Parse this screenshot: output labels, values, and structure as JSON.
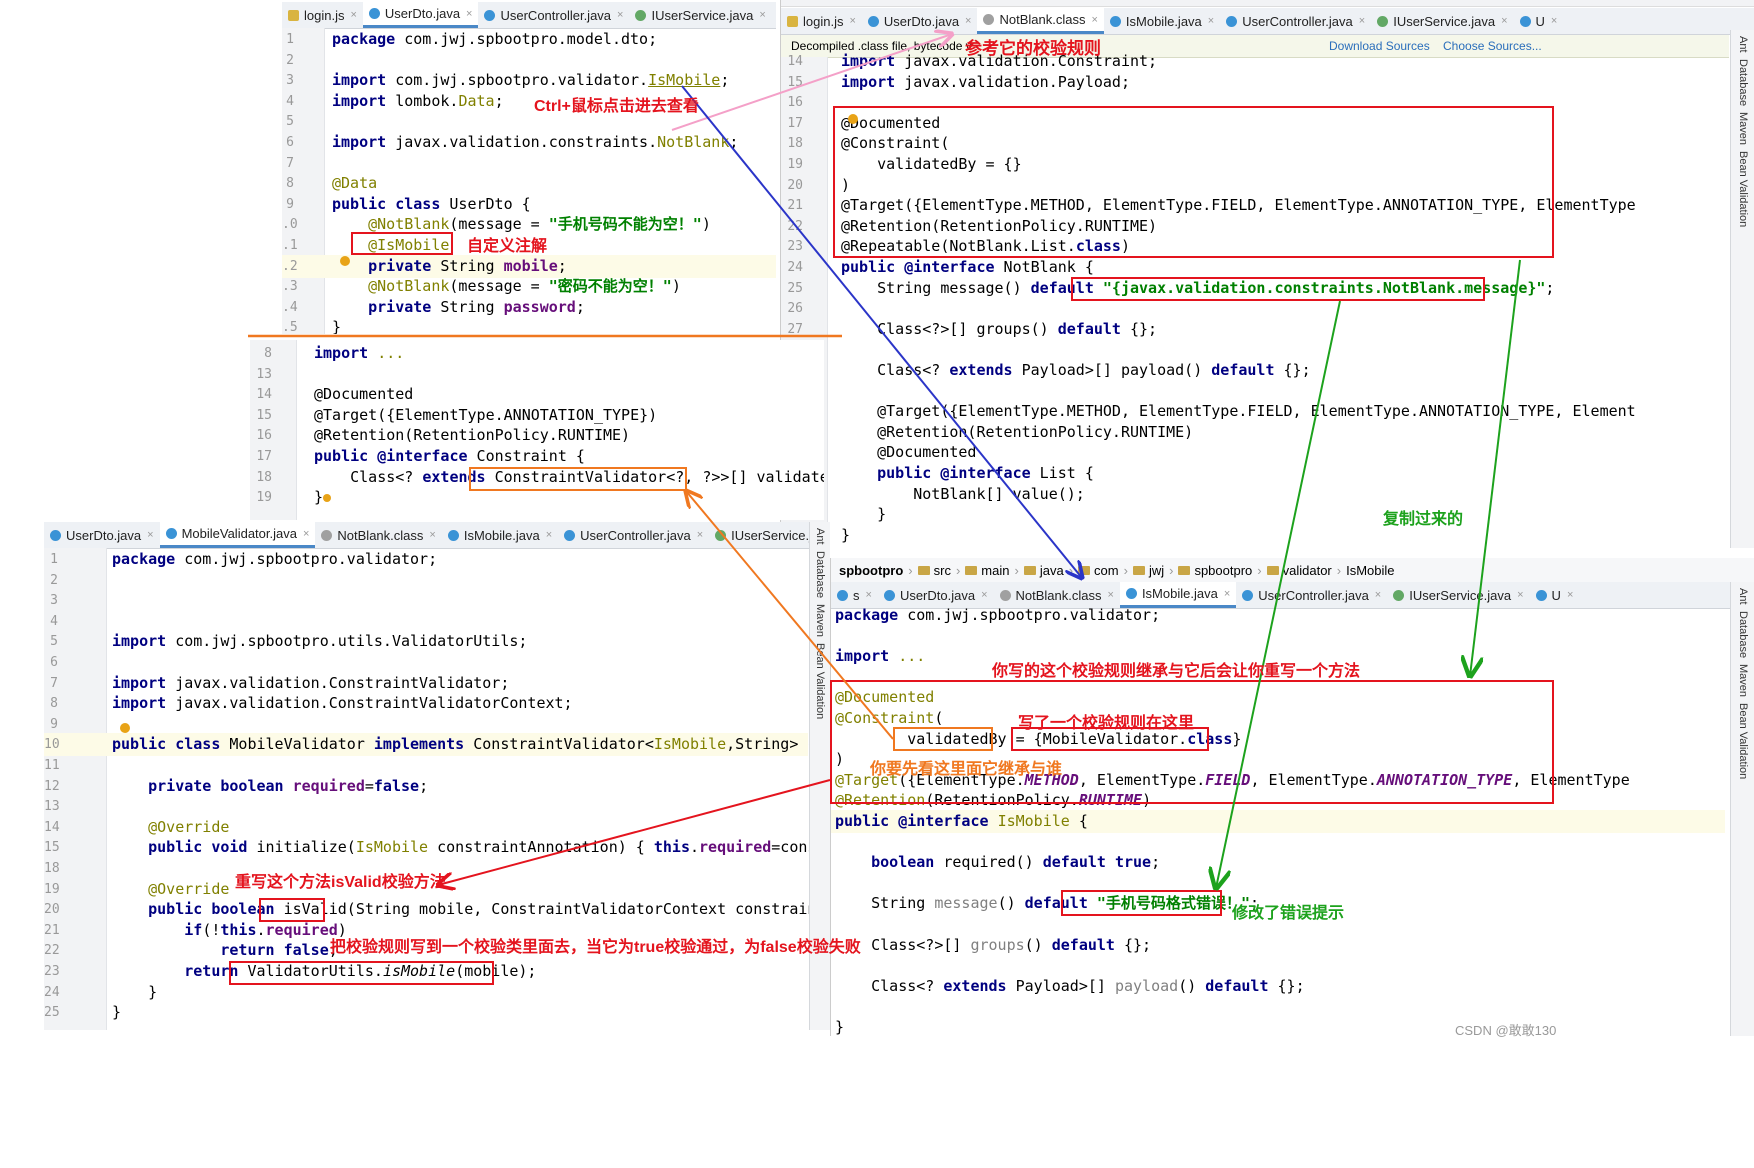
{
  "p1": {
    "tabs": [
      "login.js",
      "UserDto.java",
      "UserController.java",
      "IUserService.java",
      "Use"
    ],
    "lines": [
      {
        "n": "1",
        "html": "<span class='kw'>package</span> com.jwj.spbootpro.model.dto;"
      },
      {
        "n": "2",
        "html": ""
      },
      {
        "n": "3",
        "html": "<span class='kw'>import</span> com.jwj.spbootpro.validator.<span class='an' style='text-decoration:underline'>IsMobile</span>;"
      },
      {
        "n": "4",
        "html": "<span class='kw'>import</span> lombok.<span class='an'>Data</span>;"
      },
      {
        "n": "5",
        "html": ""
      },
      {
        "n": "6",
        "html": "<span class='kw'>import</span> javax.validation.constraints.<span class='an'>NotBlank</span>;"
      },
      {
        "n": "7",
        "html": ""
      },
      {
        "n": "8",
        "html": "<span class='an'>@Data</span>"
      },
      {
        "n": "9",
        "html": "<span class='kw'>public class</span> UserDto {"
      },
      {
        "n": ".0",
        "html": "    <span class='an'>@NotBlank</span>(message = <span class='str'>\"手机号码不能为空！\"</span>)"
      },
      {
        "n": ".1",
        "html": "    <span class='an'>@IsMobile</span>"
      },
      {
        "n": ".2",
        "html": "    <span class='kw'>private</span> String <span class='fld'>mobile</span>;"
      },
      {
        "n": ".3",
        "html": "    <span class='an'>@NotBlank</span>(message = <span class='str'>\"密码不能为空！\"</span>)"
      },
      {
        "n": ".4",
        "html": "    <span class='kw'>private</span> String <span class='fld'>password</span>;"
      },
      {
        "n": ".5",
        "html": "}"
      }
    ]
  },
  "p2": {
    "tabs": [
      "login.js",
      "UserDto.java",
      "NotBlank.class",
      "IsMobile.java",
      "UserController.java",
      "IUserService.java",
      "U"
    ],
    "decompiled_notice": "Decompiled .class file, bytecode v",
    "download_sources": "Download Sources",
    "choose_sources": "Choose Sources...",
    "sidebar_labels": [
      "Ant",
      "Database",
      "Maven",
      "Bean Validation"
    ],
    "lines": [
      {
        "n": "14",
        "html": "<span class='kw'>import</span> javax.validation.Constraint;"
      },
      {
        "n": "15",
        "html": "<span class='kw'>import</span> javax.validation.Payload;"
      },
      {
        "n": "16",
        "html": ""
      },
      {
        "n": "17",
        "html": "@Documented"
      },
      {
        "n": "18",
        "html": "@Constraint("
      },
      {
        "n": "19",
        "html": "    validatedBy = {}"
      },
      {
        "n": "20",
        "html": ")"
      },
      {
        "n": "21",
        "html": "@Target({ElementType.METHOD, ElementType.FIELD, ElementType.ANNOTATION_TYPE, ElementType"
      },
      {
        "n": "22",
        "html": "@Retention(RetentionPolicy.RUNTIME)"
      },
      {
        "n": "23",
        "html": "@Repeatable(NotBlank.List.<span class='kw'>class</span>)"
      },
      {
        "n": "24",
        "html": "<span class='kw'>public @interface</span> NotBlank {"
      },
      {
        "n": "25",
        "html": "    String message() <span class='kw'>default</span> <span class='str'>\"{javax.validation.constraints.NotBlank.message}\"</span>;"
      },
      {
        "n": "26",
        "html": ""
      },
      {
        "n": "27",
        "html": "    Class&lt;?&gt;[] groups() <span class='kw'>default</span> {};"
      },
      {
        "n": "",
        "html": ""
      },
      {
        "n": "",
        "html": "    Class&lt;? <span class='kw'>extends</span> Payload&gt;[] payload() <span class='kw'>default</span> {};"
      },
      {
        "n": "",
        "html": ""
      },
      {
        "n": "",
        "html": "    @Target({ElementType.METHOD, ElementType.FIELD, ElementType.ANNOTATION_TYPE, Element"
      },
      {
        "n": "",
        "html": "    @Retention(RetentionPolicy.RUNTIME)"
      },
      {
        "n": "",
        "html": "    @Documented"
      },
      {
        "n": "",
        "html": "    <span class='kw'>public @interface</span> List {"
      },
      {
        "n": "",
        "html": "        NotBlank[] value();"
      },
      {
        "n": "",
        "html": "    }"
      },
      {
        "n": "",
        "html": "}"
      }
    ]
  },
  "p3": {
    "lines": [
      {
        "n": "8",
        "html": "<span class='kw'>import</span> <span class='an'>...</span>"
      },
      {
        "n": "13",
        "html": ""
      },
      {
        "n": "14",
        "html": "@Documented"
      },
      {
        "n": "15",
        "html": "@Target({ElementType.ANNOTATION_TYPE})"
      },
      {
        "n": "16",
        "html": "@Retention(RetentionPolicy.RUNTIME)"
      },
      {
        "n": "17",
        "html": "<span class='kw'>public @interface</span> Constraint {"
      },
      {
        "n": "18",
        "html": "    Class&lt;? <span class='kw'>extends</span> ConstraintValidator&lt;?, ?&gt;&gt;[] validatedBy();"
      },
      {
        "n": "19",
        "html": "}"
      }
    ]
  },
  "p4": {
    "tabs": [
      "UserDto.java",
      "MobileValidator.java",
      "NotBlank.class",
      "IsMobile.java",
      "UserController.java",
      "IUserService.java"
    ],
    "sidebar_labels": [
      "Ant",
      "Database",
      "Maven",
      "Bean Validation"
    ],
    "lines": [
      {
        "n": "1",
        "html": "<span class='kw'>package</span> com.jwj.spbootpro.validator;"
      },
      {
        "n": "2",
        "html": ""
      },
      {
        "n": "3",
        "html": ""
      },
      {
        "n": "4",
        "html": ""
      },
      {
        "n": "5",
        "html": "<span class='kw'>import</span> com.jwj.spbootpro.utils.ValidatorUtils;"
      },
      {
        "n": "6",
        "html": ""
      },
      {
        "n": "7",
        "html": "<span class='kw'>import</span> javax.validation.ConstraintValidator;"
      },
      {
        "n": "8",
        "html": "<span class='kw'>import</span> javax.validation.ConstraintValidatorContext;"
      },
      {
        "n": "9",
        "html": ""
      },
      {
        "n": "10",
        "html": "<span class='kw'>public class</span> MobileValidator <span class='kw'>implements</span> ConstraintValidator&lt;<span class='an'>IsMobile</span>,String&gt; {"
      },
      {
        "n": "11",
        "html": ""
      },
      {
        "n": "12",
        "html": "    <span class='kw'>private boolean</span> <span class='fld'>required</span>=<span class='kw'>false</span>;"
      },
      {
        "n": "13",
        "html": ""
      },
      {
        "n": "14",
        "html": "    <span class='an'>@Override</span>"
      },
      {
        "n": "15",
        "html": "    <span class='kw'>public void</span> initialize(<span class='an'>IsMobile</span> constraintAnnotation) { <span class='kw'>this</span>.<span class='fld'>required</span>=constraintAnn"
      },
      {
        "n": "18",
        "html": ""
      },
      {
        "n": "19",
        "html": "    <span class='an'>@Override</span>"
      },
      {
        "n": "20",
        "html": "    <span class='kw'>public boolean</span> isValid(String mobile, ConstraintValidatorContext constraintValidatc"
      },
      {
        "n": "21",
        "html": "        <span class='kw'>if</span>(!<span class='kw'>this</span>.<span class='fld'>required</span>)"
      },
      {
        "n": "22",
        "html": "            <span class='kw'>return false</span>;"
      },
      {
        "n": "23",
        "html": "        <span class='kw'>return</span> ValidatorUtils.<span class='ital'>isMobile</span>(mobile);"
      },
      {
        "n": "24",
        "html": "    }"
      },
      {
        "n": "25",
        "html": "}"
      }
    ]
  },
  "p5": {
    "breadcrumb": [
      "spbootpro",
      "src",
      "main",
      "java",
      "com",
      "jwj",
      "spbootpro",
      "validator",
      "IsMobile"
    ],
    "tabs": [
      "s",
      "UserDto.java",
      "NotBlank.class",
      "IsMobile.java",
      "UserController.java",
      "IUserService.java",
      "U"
    ],
    "sidebar_labels": [
      "Ant",
      "Database",
      "Maven",
      "Bean Validation"
    ],
    "lines": [
      {
        "html": "<span class='kw'>package</span> com.jwj.spbootpro.validator;"
      },
      {
        "html": ""
      },
      {
        "html": "<span class='kw'>import</span> <span class='an'>...</span>"
      },
      {
        "html": ""
      },
      {
        "html": "<span class='an'>@Documented</span>"
      },
      {
        "html": "<span class='an'>@Constraint</span>("
      },
      {
        "html": "        validatedBy = {MobileValidator.<span class='kw'>class</span>}"
      },
      {
        "html": ")"
      },
      {
        "html": "<span class='an'>@Target</span>({ElementType.<span class='fld ital'>METHOD</span>, ElementType.<span class='fld ital'>FIELD</span>, ElementType.<span class='fld ital'>ANNOTATION_TYPE</span>, ElementType"
      },
      {
        "html": "<span class='an'>@Retention</span>(RetentionPolicy.<span class='fld ital'>RUNTIME</span>)"
      },
      {
        "html": "<span class='kw'>public @interface</span> <span class='an'>IsMobile</span> {"
      },
      {
        "html": ""
      },
      {
        "html": "    <span class='kw'>boolean</span> required() <span class='kw'>default true</span>;"
      },
      {
        "html": ""
      },
      {
        "html": "    String <span style='color:#808080'>message</span>() <span class='kw'>default</span> <span class='str'>\"手机号码格式错误！\"</span>;"
      },
      {
        "html": ""
      },
      {
        "html": "    Class&lt;?&gt;[] <span style='color:#808080'>groups</span>() <span class='kw'>default</span> {};"
      },
      {
        "html": ""
      },
      {
        "html": "    Class&lt;? <span class='kw'>extends</span> Payload&gt;[] <span style='color:#808080'>payload</span>() <span class='kw'>default</span> {};"
      },
      {
        "html": ""
      },
      {
        "html": "}"
      }
    ]
  },
  "annotations": {
    "ref_rules": "参考它的校验规则",
    "ctrl_click": "Ctrl+鼠标点击进去查看",
    "custom_annotation": "自定义注解",
    "copied_over": "复制过来的",
    "inherit_note": "你写的这个校验规则继承与它后会让你重写一个方法",
    "wrote_rule": "写了一个校验规则在这里",
    "see_parent": "你要先看这里面它继承与谁",
    "override_isvalid": "重写这个方法isValid校验方法",
    "write_rule_into_class": "把校验规则写到一个校验类里面去，当它为true校验通过，为false校验失败",
    "changed_message": "修改了错误提示",
    "watermark": "CSDN @敢敢130"
  },
  "colors": {
    "red": "#e4141e",
    "green": "#1da21d",
    "orange": "#f07820",
    "pink": "#f4a0c8",
    "blue": "#2b35c8"
  }
}
